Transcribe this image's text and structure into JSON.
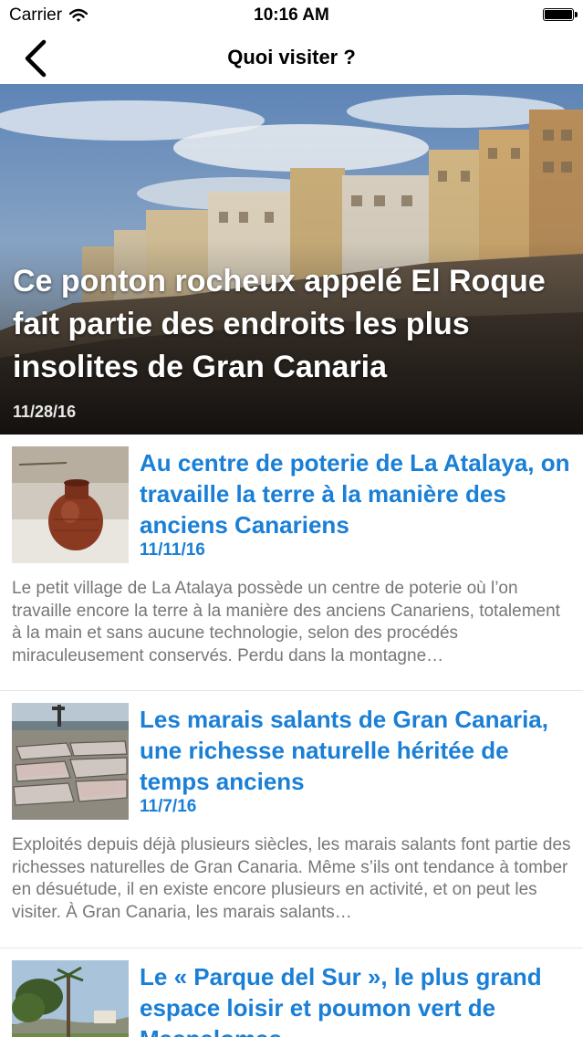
{
  "status_bar": {
    "carrier": "Carrier",
    "time": "10:16 AM"
  },
  "nav": {
    "title": "Quoi visiter ?"
  },
  "hero": {
    "title": "Ce ponton rocheux appelé El Roque fait partie des endroits les plus insolites de Gran Canaria",
    "date": "11/28/16"
  },
  "articles": [
    {
      "title": "Au centre de poterie de La Atalaya, on travaille la terre à la manière des anciens Canariens",
      "date": "11/11/16",
      "excerpt": "Le petit village de La Atalaya possède un centre de poterie où l’on travaille encore la terre à la manière des anciens Canariens, totalement à la main et sans aucune technologie, selon des procédés miraculeusement conservés. Perdu dans la montagne…"
    },
    {
      "title": "Les marais salants de Gran Canaria, une richesse naturelle héritée de temps anciens",
      "date": "11/7/16",
      "excerpt": "Exploités depuis déjà plusieurs siècles, les marais salants font partie des richesses naturelles de Gran Canaria. Même s’ils ont tendance à tomber en désuétude,  il en existe encore plusieurs en activité, et on peut les visiter. À Gran Canaria, les marais salants…"
    },
    {
      "title": "Le « Parque del Sur », le plus grand espace loisir et poumon vert de Maspalomas",
      "date": "",
      "excerpt": ""
    }
  ]
}
